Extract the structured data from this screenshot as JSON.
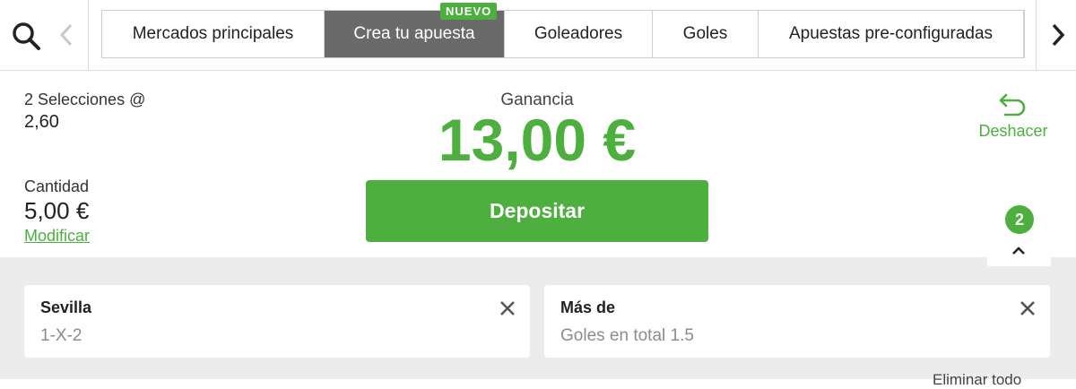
{
  "tabs": [
    {
      "label": "Mercados principales",
      "active": false
    },
    {
      "label": "Crea tu apuesta",
      "active": true
    },
    {
      "label": "Goleadores",
      "active": false
    },
    {
      "label": "Goles",
      "active": false
    },
    {
      "label": "Apuestas pre-configuradas",
      "active": false
    }
  ],
  "new_badge": "NUEVO",
  "summary": {
    "selections_label": "2 Selecciones @",
    "odds": "2,60",
    "quantity_label": "Cantidad",
    "quantity_value": "5,00 €",
    "modify_label": "Modificar",
    "gain_label": "Ganancia",
    "gain_value": "13,00 €",
    "deposit_label": "Depositar",
    "undo_label": "Deshacer"
  },
  "selection_count": "2",
  "selections": [
    {
      "title": "Sevilla",
      "market": "1-X-2"
    },
    {
      "title": "Más de",
      "market": "Goles en total 1.5"
    }
  ],
  "partial_text": "Eliminar todo",
  "icons": {
    "search": "search-icon",
    "left": "chevron-left-icon",
    "right": "chevron-right-icon",
    "undo": "undo-icon",
    "collapse": "chevron-up-icon",
    "close": "close-icon"
  },
  "colors": {
    "accent": "#4caf3e",
    "active_tab": "#6a6a6a",
    "panel": "#ececec"
  }
}
